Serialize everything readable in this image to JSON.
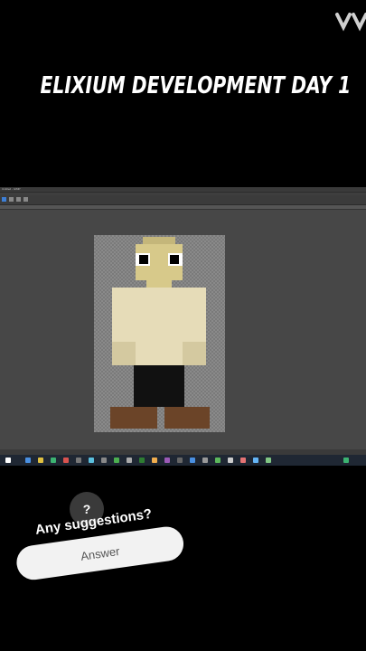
{
  "header": {
    "title": "ELIXIUM DEVELOPMENT DAY 1"
  },
  "editor": {
    "window_title": "Untitled - GIMP",
    "colors": {
      "skin": "#d7c98a",
      "shirt": "#e6dcb8",
      "pants": "#111111",
      "boots": "#6b4428",
      "hair": "#c4b67a"
    }
  },
  "overlay": {
    "prompt": "Any suggestions?",
    "answer_label": "Answer",
    "question_icon": "question-bubble-icon"
  }
}
